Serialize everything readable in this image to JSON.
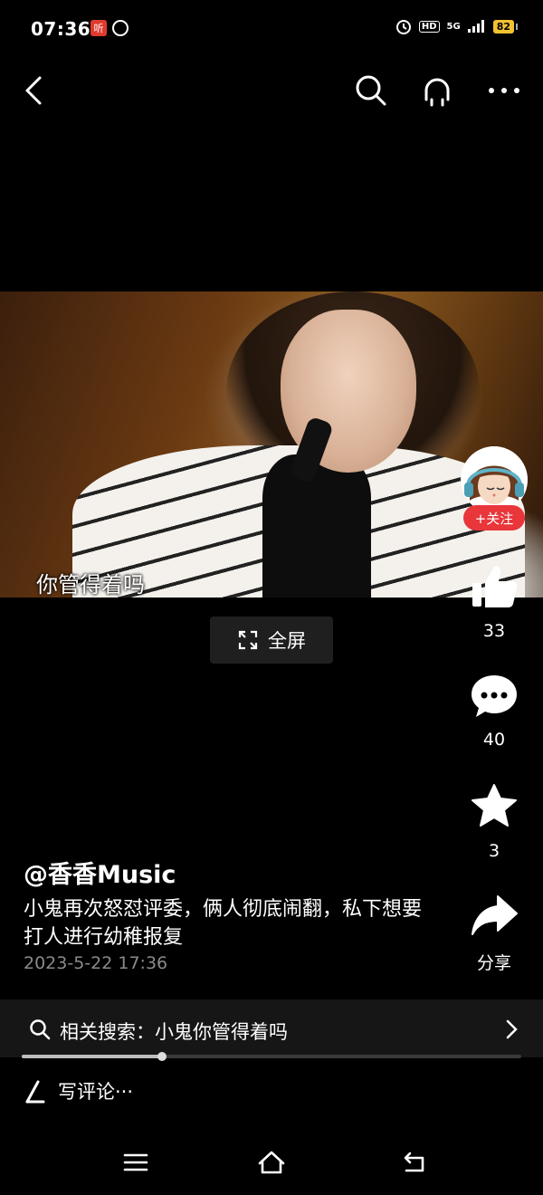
{
  "status_bar": {
    "time": "07:36",
    "app_icon_1": "听",
    "network": "HD",
    "signal": "5G",
    "battery": "82"
  },
  "icons": {
    "back": "back-icon",
    "search": "search-icon",
    "listen": "headphone-icon",
    "more": "more-icon",
    "fullscreen": "expand-icon",
    "like": "thumb-up-icon",
    "comment": "comment-icon",
    "favorite": "star-icon",
    "share": "share-icon",
    "related_search": "search-icon",
    "edit": "pen-icon",
    "chevron": "chevron-right-icon"
  },
  "video": {
    "subtitle": "你管得着吗"
  },
  "controls": {
    "fullscreen_label": "全屏"
  },
  "rail": {
    "follow_label": "+关注",
    "likes": "33",
    "comments": "40",
    "favorites": "3",
    "share_label": "分享"
  },
  "post": {
    "author": "@香香Music",
    "description": "小鬼再次怒怼评委，俩人彻底闹翻，私下想要打人进行幼稚报复",
    "date": "2023-5-22 17:36"
  },
  "related": {
    "text": "相关搜索：小鬼你管得着吗"
  },
  "playback": {
    "progress": 0.28
  },
  "comment_input": {
    "placeholder": "写评论···"
  },
  "colors": {
    "follow": "#e8363b",
    "background": "#000000"
  }
}
